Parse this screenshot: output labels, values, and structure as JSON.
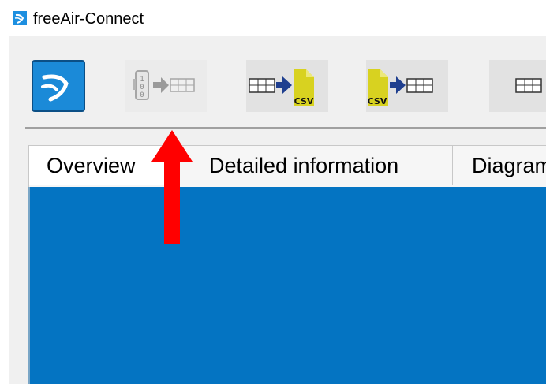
{
  "window": {
    "title": "freeAir-Connect",
    "app_icon": "freeair-logo-icon"
  },
  "toolbar": {
    "buttons": [
      {
        "name": "freeair-main-button",
        "icon": "freeair-logo-icon",
        "enabled": true
      },
      {
        "name": "read-device-data-button",
        "icon": "device-to-table-icon",
        "enabled": false
      },
      {
        "name": "export-csv-button",
        "icon": "table-to-csv-icon",
        "enabled": true,
        "badge": "CSV"
      },
      {
        "name": "import-csv-button",
        "icon": "csv-to-table-icon",
        "enabled": true,
        "badge": "CSV"
      },
      {
        "name": "more-button",
        "icon": "table-icon",
        "enabled": true
      }
    ]
  },
  "tabs": [
    {
      "label": "Overview",
      "active": true
    },
    {
      "label": "Detailed information",
      "active": false
    },
    {
      "label": "Diagram",
      "active": false
    }
  ],
  "annotation": {
    "type": "arrow",
    "color": "#ff0000",
    "points_to": "read-device-data-button"
  },
  "colors": {
    "panel_blue": "#0474c2",
    "brand_blue": "#1b8ad8",
    "csv_yellow": "#d8d220",
    "arrow_red": "#ff0000"
  }
}
